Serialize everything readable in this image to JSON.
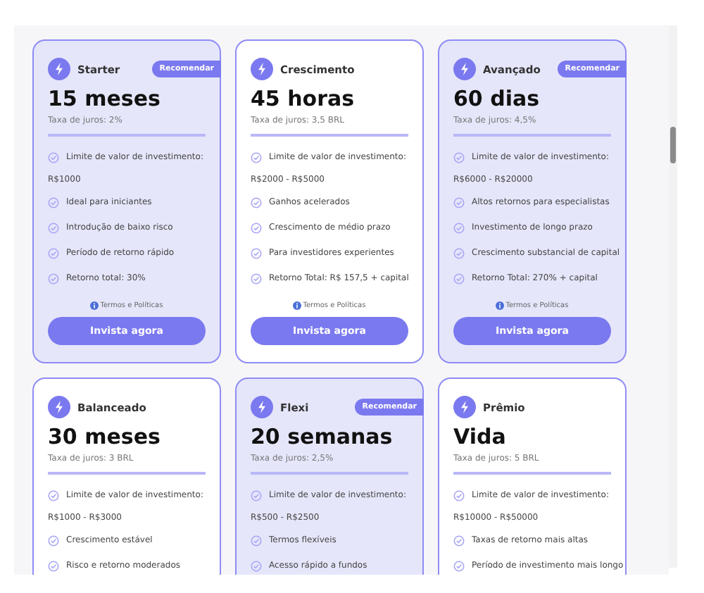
{
  "plans": [
    {
      "name": "Starter",
      "recommended": true,
      "badge": "Recomendar",
      "duration": "15 meses",
      "rate": "Taxa de juros: 2%",
      "limit_label": "Limite de valor de investimento:",
      "limit_value": "R$1000",
      "features": [
        "Ideal para iniciantes",
        "Introdução de baixo risco",
        "Período de retorno rápido",
        "Retorno total: 30%"
      ],
      "terms": "Termos e Políticas",
      "button": "Invista agora"
    },
    {
      "name": "Crescimento",
      "recommended": false,
      "duration": "45 horas",
      "rate": "Taxa de juros: 3,5 BRL",
      "limit_label": "Limite de valor de investimento:",
      "limit_value": "R$2000 - R$5000",
      "features": [
        "Ganhos acelerados",
        "Crescimento de médio prazo",
        "Para investidores experientes",
        "Retorno Total: R$ 157,5 + capital"
      ],
      "terms": "Termos e Políticas",
      "button": "Invista agora"
    },
    {
      "name": "Avançado",
      "recommended": true,
      "badge": "Recomendar",
      "duration": "60 dias",
      "rate": "Taxa de juros: 4,5%",
      "limit_label": "Limite de valor de investimento:",
      "limit_value": "R$6000 - R$20000",
      "features": [
        "Altos retornos para especialistas",
        "Investimento de longo prazo",
        "Crescimento substancial de capital",
        "Retorno Total: 270% + capital"
      ],
      "terms": "Termos e Políticas",
      "button": "Invista agora"
    },
    {
      "name": "Balanceado",
      "recommended": false,
      "duration": "30 meses",
      "rate": "Taxa de juros: 3 BRL",
      "limit_label": "Limite de valor de investimento:",
      "limit_value": "R$1000 - R$3000",
      "features": [
        "Crescimento estável",
        "Risco e retorno moderados"
      ]
    },
    {
      "name": "Flexi",
      "recommended": true,
      "badge": "Recomendar",
      "duration": "20 semanas",
      "rate": "Taxa de juros: 2,5%",
      "limit_label": "Limite de valor de investimento:",
      "limit_value": "R$500 - R$2500",
      "features": [
        "Termos flexíveis",
        "Acesso rápido a fundos"
      ]
    },
    {
      "name": "Prêmio",
      "recommended": false,
      "duration": "Vida",
      "rate": "Taxa de juros: 5 BRL",
      "limit_label": "Limite de valor de investimento:",
      "limit_value": "R$10000 - R$50000",
      "features": [
        "Taxas de retorno mais altas",
        "Período de investimento mais longo"
      ]
    }
  ]
}
